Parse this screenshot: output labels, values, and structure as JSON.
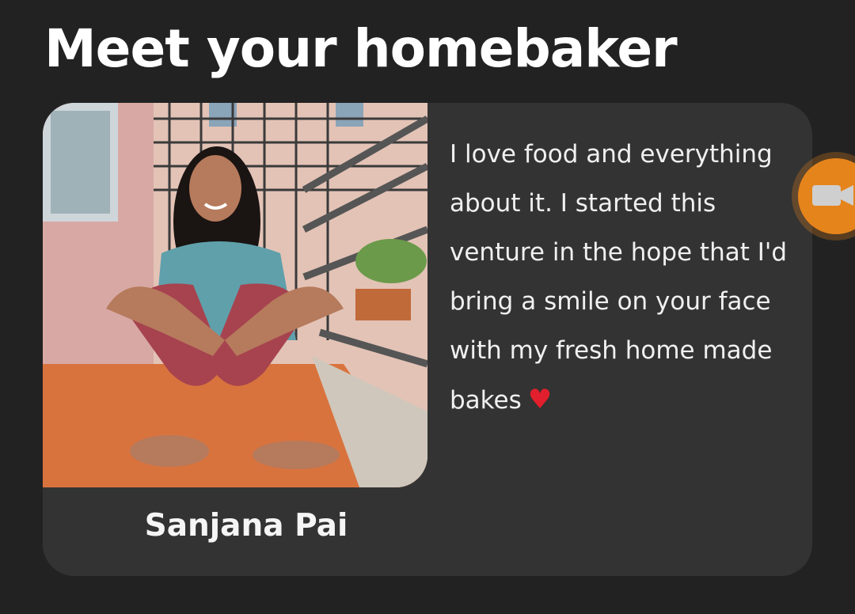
{
  "page": {
    "title": "Meet your homebaker"
  },
  "baker": {
    "name": "Sanjana Pai",
    "bio": "I love food and everything about it. I started this venture in the hope that I'd bring a smile on your face with my fresh home made bakes",
    "bio_emoji": "♥",
    "photo_icon": "baker-photo"
  },
  "fab": {
    "icon": "video-camera-icon"
  },
  "colors": {
    "background": "#222222",
    "card": "#333333",
    "accent": "#e6841c",
    "heart": "#e21f2c"
  }
}
